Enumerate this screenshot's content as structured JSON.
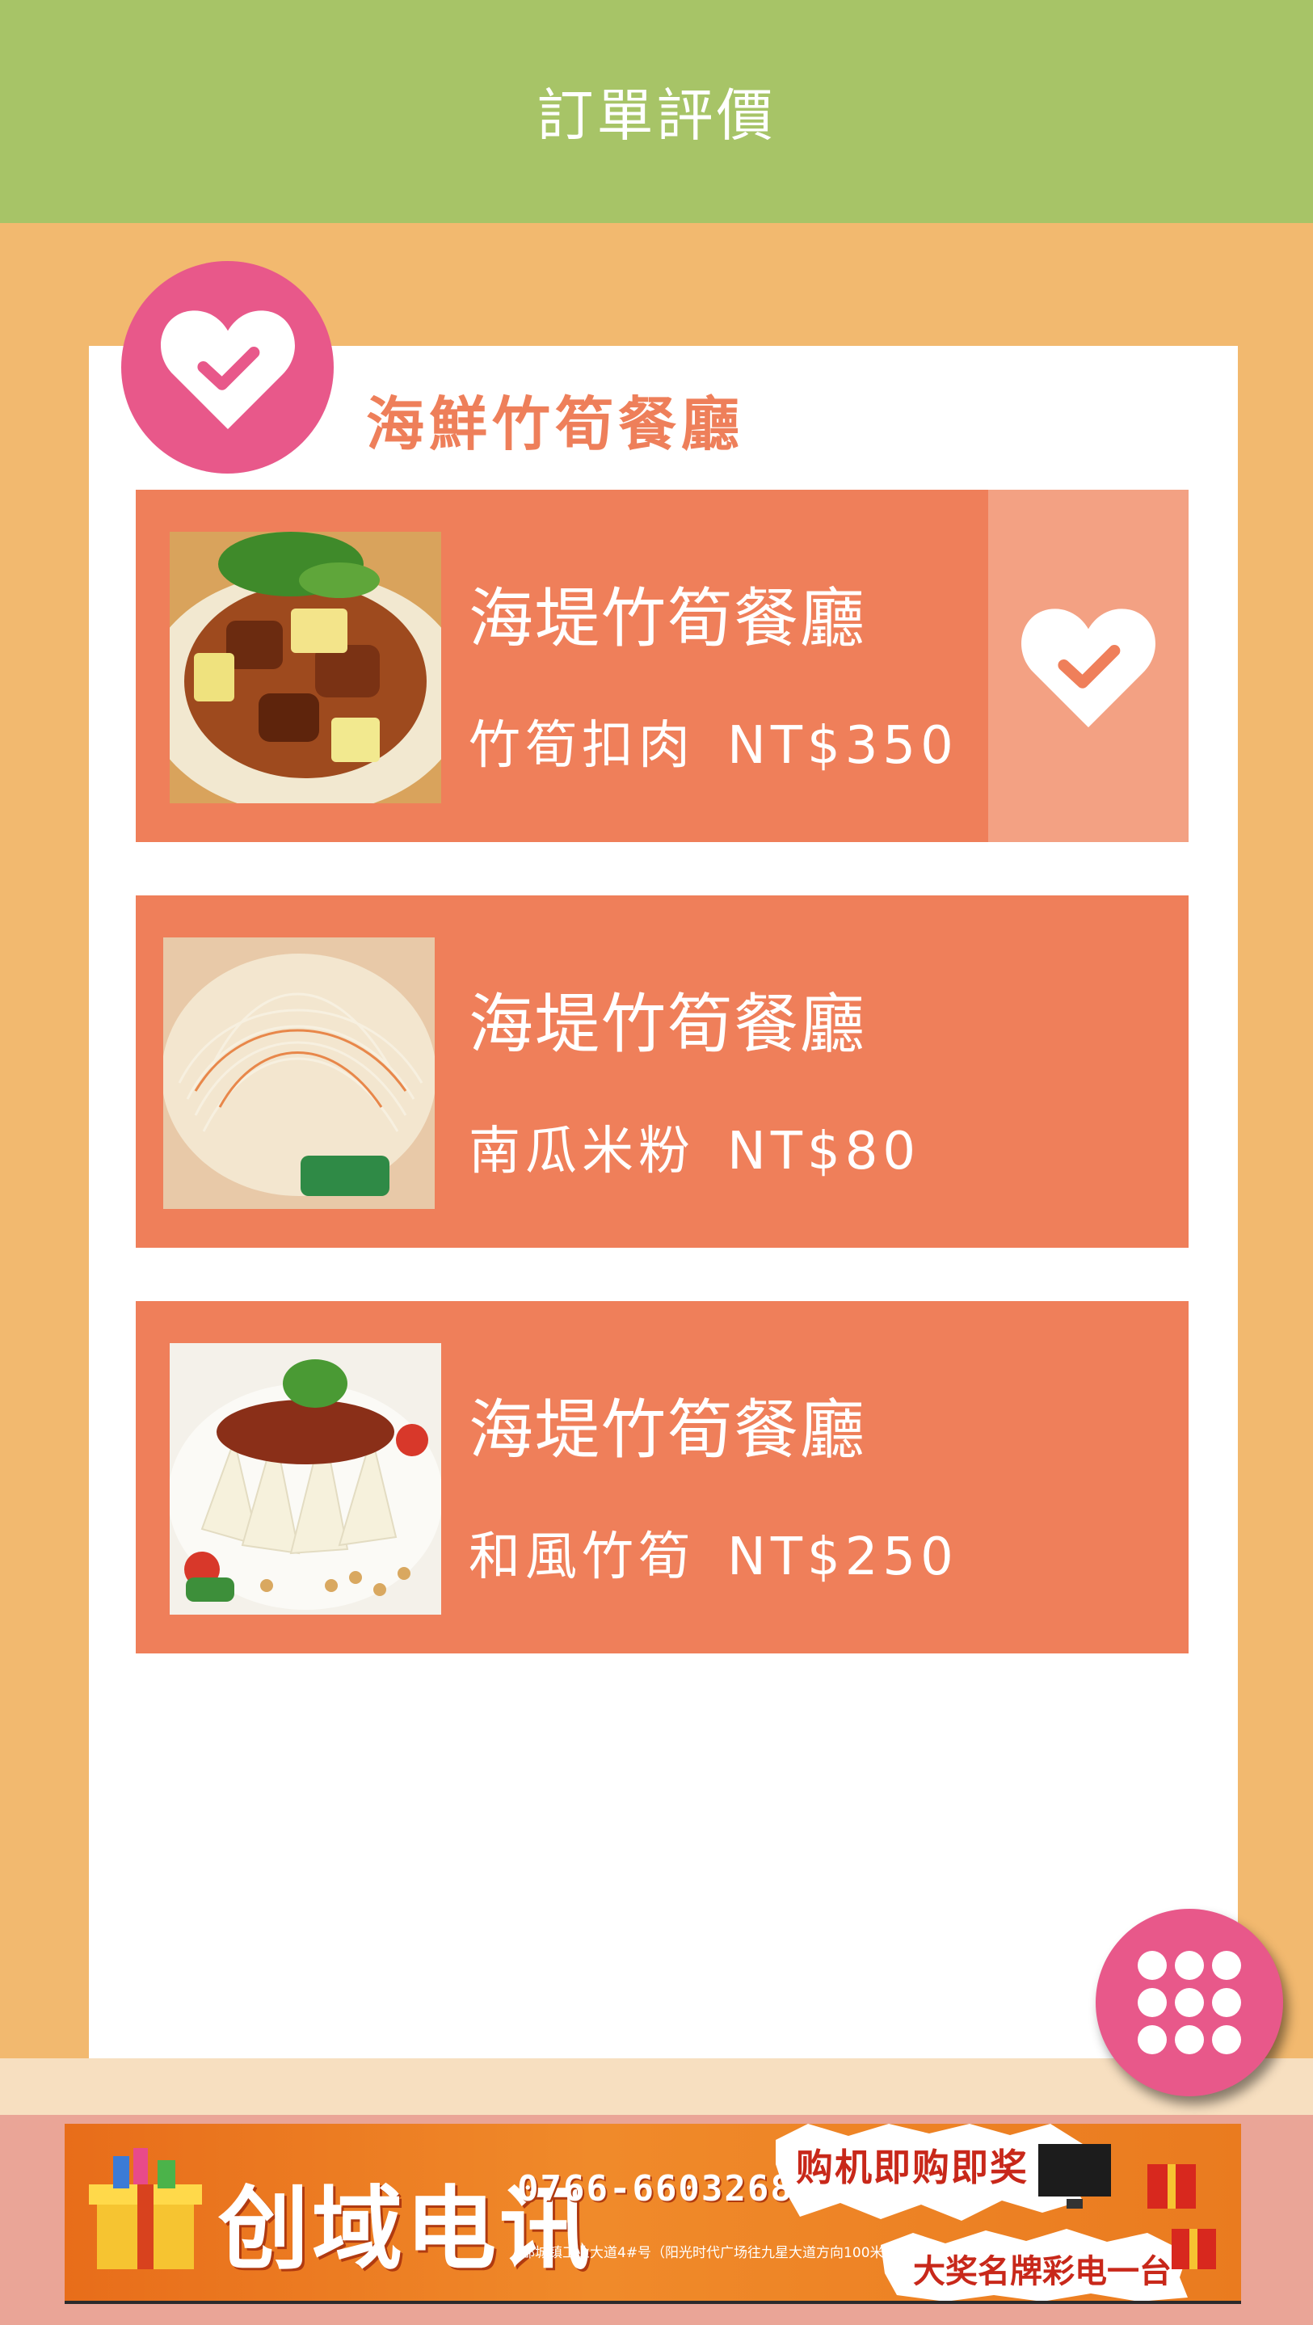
{
  "header": {
    "title": "訂單評價"
  },
  "restaurant": {
    "title": "海鮮竹筍餐廳"
  },
  "orders": [
    {
      "restaurant": "海堤竹筍餐廳",
      "dish": "竹筍扣肉",
      "price": "NT$350",
      "rated": true
    },
    {
      "restaurant": "海堤竹筍餐廳",
      "dish": "南瓜米粉",
      "price": "NT$80",
      "rated": false
    },
    {
      "restaurant": "海堤竹筍餐廳",
      "dish": "和風竹筍",
      "price": "NT$250",
      "rated": false
    }
  ],
  "icons": {
    "badge": "heart-check-icon",
    "rate": "heart-check-icon",
    "menu": "grid-menu-icon"
  },
  "ad": {
    "brand": "创域电讯",
    "phone": "0766-6603268",
    "address": "郡城镇工业大道4#号（阳光时代广场往九星大道方向100米）",
    "promo": "购机即购即奖",
    "prize": "大奖名牌彩电一台"
  },
  "colors": {
    "header": "#a7c467",
    "background": "#f2b96f",
    "accent": "#e8588a",
    "order_card": "#ef7f5a",
    "rated_panel": "#f3a183"
  }
}
